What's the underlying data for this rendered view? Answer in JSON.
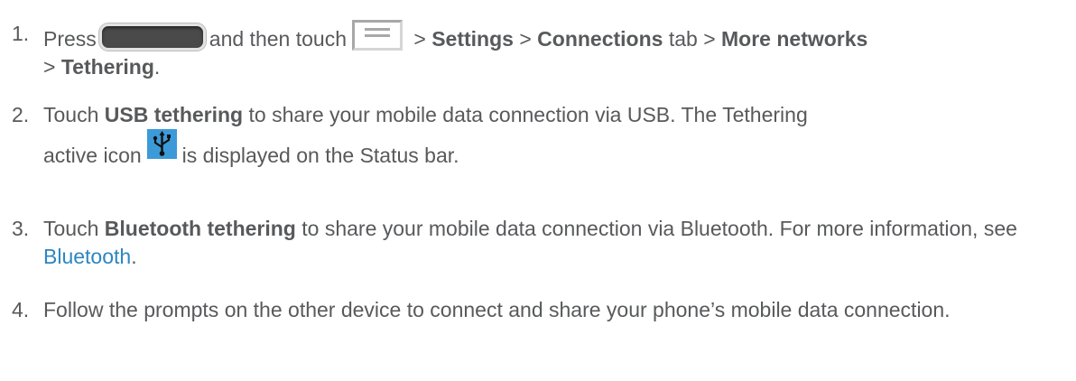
{
  "steps": [
    {
      "number": "1.",
      "t1": "Press",
      "t2": "and then touch",
      "t3": " > ",
      "b1": "Settings",
      "t4": " > ",
      "b2": "Connections",
      "t5": " tab > ",
      "b3": "More networks",
      "t6": "> ",
      "b4": "Tethering",
      "t7": "."
    },
    {
      "number": "2.",
      "t1": "Touch ",
      "b1": "USB tethering",
      "t2": " to share your mobile data connection via USB. The Tethering",
      "t3": "active icon",
      "t4": "is displayed on the Status bar."
    },
    {
      "number": "3.",
      "t1": "Touch ",
      "b1": "Bluetooth tethering",
      "t2": " to share your mobile data connection via Bluetooth. For more information, see ",
      "link": "Bluetooth",
      "t3": "."
    },
    {
      "number": "4.",
      "t1": "Follow the prompts on the other device to connect and share your phone’s mobile data connection."
    }
  ],
  "icons": {
    "home_button": "home-key-icon",
    "menu_button": "menu-key-icon",
    "usb_tether": "usb-tethering-icon"
  },
  "colors": {
    "text": "#58595b",
    "link": "#2c86c2",
    "usb_icon_bg": "#3c9ad8"
  }
}
